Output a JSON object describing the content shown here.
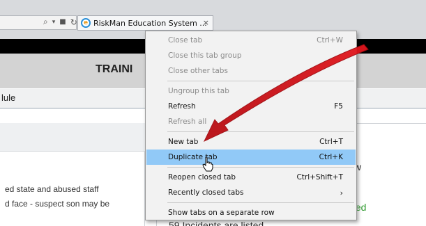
{
  "browser": {
    "address_icons": [
      "⌕",
      "▾",
      "🔒",
      "↻"
    ],
    "tab_title": "RiskMan Education System ...",
    "tab_close": "×"
  },
  "page": {
    "banner_title": "TRAINI",
    "nav_text": "lule",
    "left_panel": {
      "lines": [
        "ed state and abused staff",
        "d face - suspect son may be"
      ]
    },
    "right_panel": {
      "frag_w": "w",
      "frag_green": "ted",
      "frag_bottom": "59 Incidents are listed"
    }
  },
  "context_menu": {
    "items": [
      {
        "label": "Close tab",
        "shortcut": "Ctrl+W",
        "disabled": true
      },
      {
        "label": "Close this tab group",
        "shortcut": "",
        "disabled": true
      },
      {
        "label": "Close other tabs",
        "shortcut": "",
        "disabled": true
      },
      {
        "label": "Ungroup this tab",
        "shortcut": "",
        "disabled": true
      },
      {
        "label": "Refresh",
        "shortcut": "F5",
        "disabled": false
      },
      {
        "label": "Refresh all",
        "shortcut": "",
        "disabled": true
      },
      {
        "label": "New tab",
        "shortcut": "Ctrl+T",
        "disabled": false
      },
      {
        "label": "Duplicate tab",
        "shortcut": "Ctrl+K",
        "disabled": false,
        "highlighted": true
      },
      {
        "label": "Reopen closed tab",
        "shortcut": "Ctrl+Shift+T",
        "disabled": false
      },
      {
        "label": "Recently closed tabs",
        "shortcut": "›",
        "disabled": false
      },
      {
        "label": "Show tabs on a separate row",
        "shortcut": "",
        "disabled": false
      }
    ]
  },
  "colors": {
    "highlight": "#91c9f7",
    "annotation_arrow": "#d9141b",
    "green_text": "#2e9a2e"
  }
}
